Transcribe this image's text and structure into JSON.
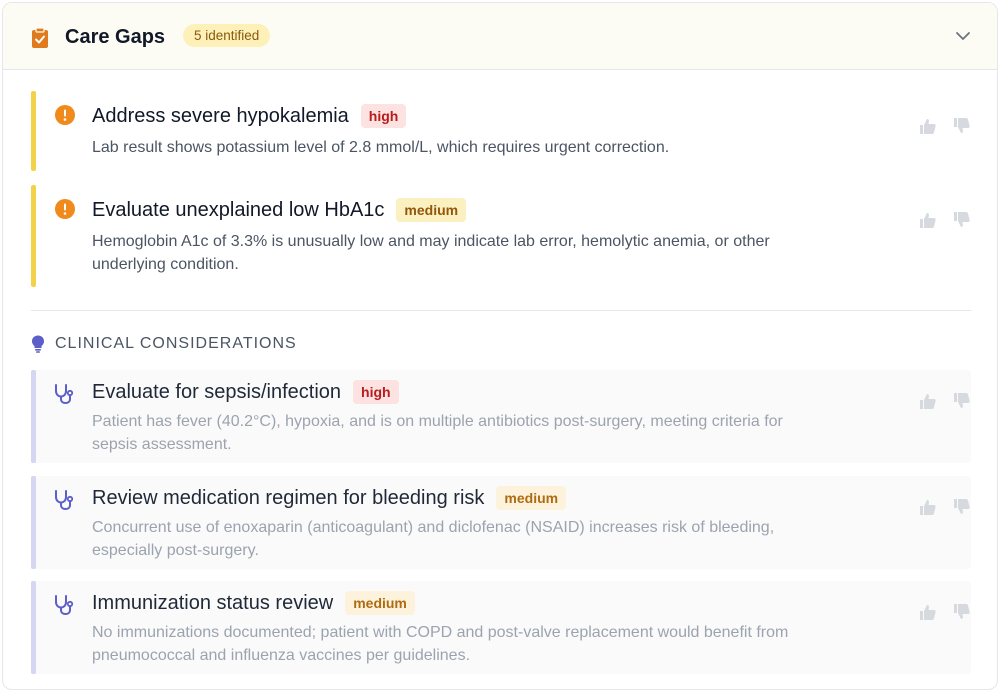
{
  "header": {
    "title": "Care Gaps",
    "count_badge": "5 identified"
  },
  "gaps": [
    {
      "title": "Address severe hypokalemia",
      "severity": "high",
      "description": "Lab result shows potassium level of 2.8 mmol/L, which requires urgent correction."
    },
    {
      "title": "Evaluate unexplained low HbA1c",
      "severity": "medium",
      "description_line1": "Hemoglobin A1c of 3.3% is unusually low and may indicate lab error, hemolytic anemia, or other",
      "description_line2": "underlying condition."
    }
  ],
  "considerations": {
    "heading": "CLINICAL CONSIDERATIONS",
    "items": [
      {
        "title": "Evaluate for sepsis/infection",
        "severity": "high",
        "description_line1": "Patient has fever (40.2°C), hypoxia, and is on multiple antibiotics post-surgery, meeting criteria for",
        "description_line2": "sepsis assessment."
      },
      {
        "title": "Review medication regimen for bleeding risk",
        "severity": "medium",
        "description_line1": "Concurrent use of enoxaparin (anticoagulant) and diclofenac (NSAID) increases risk of bleeding,",
        "description_line2": "especially post-surgery."
      },
      {
        "title": "Immunization status review",
        "severity": "medium",
        "description_line1": "No immunizations documented; patient with COPD and post-valve replacement would benefit from",
        "description_line2": "pneumococcal and influenza vaccines per guidelines."
      }
    ]
  },
  "colors": {
    "accent_yellow": "#f3d24a",
    "alert_orange": "#f08a1c",
    "consideration_bar": "#d4d6f2",
    "icon_purple": "#5b5fc7"
  },
  "icons": [
    "clipboard-check-icon",
    "chevron-down-icon",
    "alert-circle-icon",
    "thumbs-up-icon",
    "thumbs-down-icon",
    "lightbulb-icon",
    "stethoscope-icon"
  ]
}
